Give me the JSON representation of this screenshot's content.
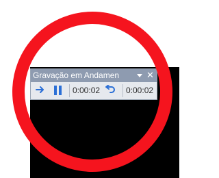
{
  "toolbar": {
    "title": "Gravação em Andamen",
    "slide_time": "0:00:02",
    "total_time": "0:00:02",
    "icons": {
      "next": "next-arrow-icon",
      "pause": "pause-icon",
      "repeat": "undo-arrow-icon",
      "menu": "dropdown-arrow-icon",
      "close": "close-icon"
    }
  },
  "colors": {
    "ring": "#f5141e",
    "accent_icon": "#2b6fd6",
    "titlebar": "#8e9bb0",
    "slide_background": "#000000"
  }
}
